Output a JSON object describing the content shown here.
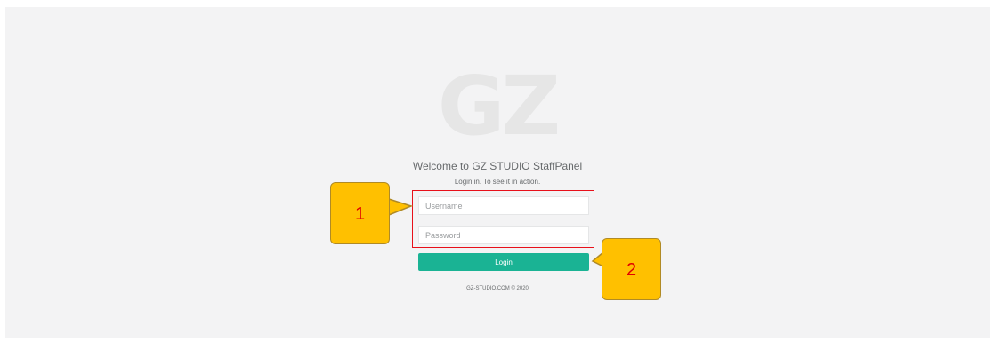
{
  "logo": {
    "text": "GZ"
  },
  "login": {
    "welcome": "Welcome to GZ STUDIO StaffPanel",
    "subtitle": "Login in. To see it in action.",
    "username_placeholder": "Username",
    "password_placeholder": "Password",
    "login_label": "Login",
    "footer": "GZ-STUDIO.COM © 2020"
  },
  "annotations": {
    "callout_1_label": "1",
    "callout_2_label": "2",
    "callout_color": "#ffc000",
    "callout_text_color": "#e00000",
    "highlight_color": "#e8101a"
  },
  "colors": {
    "accent": "#1ab394",
    "background": "#f3f3f4"
  }
}
